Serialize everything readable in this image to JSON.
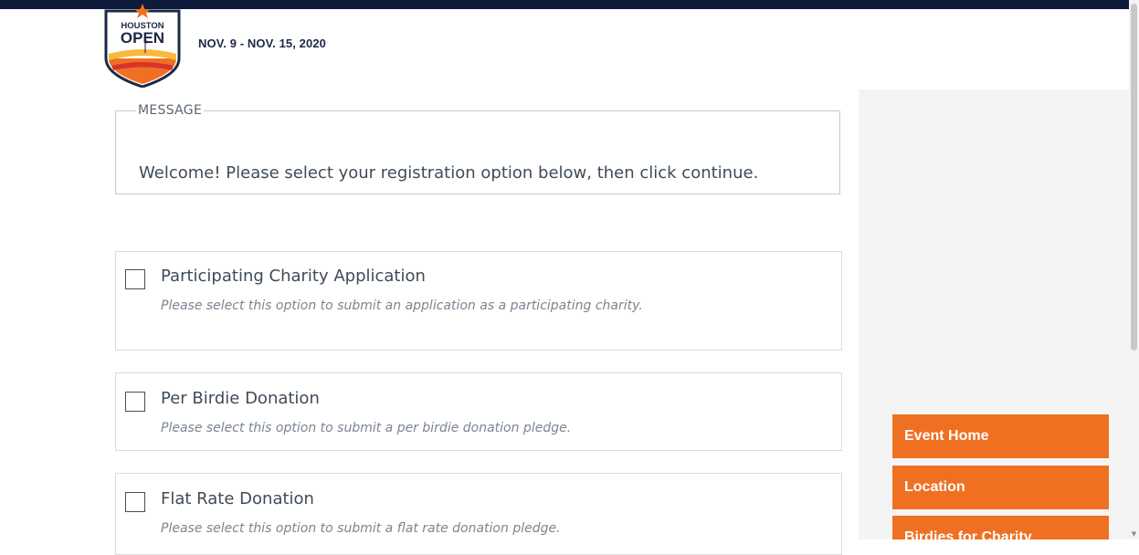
{
  "header": {
    "logo": {
      "line1": "HOUSTON",
      "line2": "OPEN",
      "colors": {
        "navy": "#1d2847",
        "orange": "#f07022",
        "yellow": "#f8b93c",
        "red": "#d8342c"
      }
    },
    "event_date": "NOV. 9 - NOV. 15, 2020",
    "bar_color": "#0f1b3a"
  },
  "message": {
    "legend": "MESSAGE",
    "text": "Welcome! Please select your registration option below, then click continue."
  },
  "options": [
    {
      "title": "Participating Charity Application",
      "description": "Please select this option to submit an application as a participating charity.",
      "checked": false
    },
    {
      "title": "Per Birdie Donation",
      "description": "Please select this option to submit a per birdie donation pledge.",
      "checked": false
    },
    {
      "title": "Flat Rate Donation",
      "description": "Please select this option to submit a flat rate donation pledge.",
      "checked": false
    }
  ],
  "nav": {
    "items": [
      {
        "label": "Event Home"
      },
      {
        "label": "Location"
      },
      {
        "label": "Birdies for Charity"
      }
    ],
    "color": "#f07022"
  }
}
